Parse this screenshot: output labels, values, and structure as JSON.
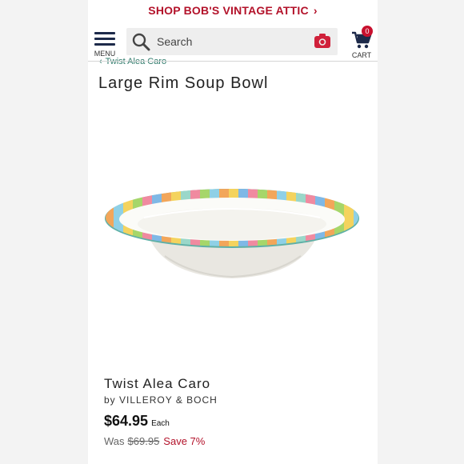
{
  "promo": {
    "text": "SHOP BOB'S VINTAGE ATTIC",
    "chevron": "›"
  },
  "header": {
    "menu_label": "MENU",
    "search_placeholder": "Search",
    "cart_label": "CART",
    "cart_count": "0"
  },
  "breadcrumb": {
    "arrow": "‹",
    "label": "Twist Alea Caro"
  },
  "product": {
    "title": "Large Rim Soup Bowl",
    "collection": "Twist Alea Caro",
    "brand_prefix": "by",
    "brand": "VILLEROY & BOCH",
    "price": "$64.95",
    "price_unit": "Each",
    "was_label": "Was",
    "was_price": "$69.95",
    "save_text": "Save 7%"
  },
  "icons": {
    "menu": "hamburger-icon",
    "search": "search-icon",
    "camera": "camera-icon",
    "cart": "cart-icon"
  },
  "colors": {
    "promo": "#b3122a",
    "nav": "#1d2a4a",
    "badge": "#c8102e",
    "breadcrumb": "#2f7a6b",
    "save": "#b3122a"
  }
}
